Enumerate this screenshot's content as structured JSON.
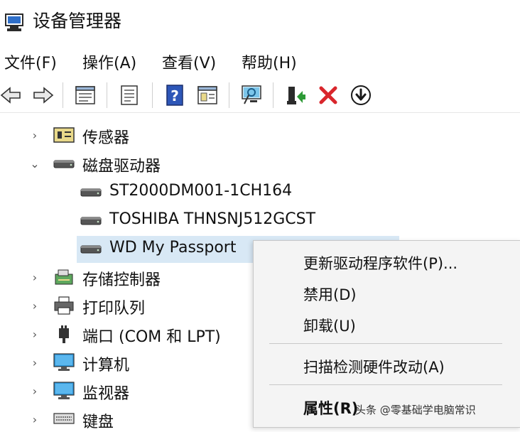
{
  "window": {
    "title": "设备管理器",
    "icon": "device-manager-icon"
  },
  "menu": [
    "文件(F)",
    "操作(A)",
    "查看(V)",
    "帮助(H)"
  ],
  "toolbar": {
    "buttons": [
      "back-arrow-icon",
      "forward-arrow-icon",
      "properties-icon",
      "driver-details-icon",
      "help-icon",
      "action-icon",
      "scan-monitor-icon",
      "update-driver-icon",
      "uninstall-x-icon",
      "download-icon"
    ],
    "uninstall_color": "#d9262c",
    "update_color": "#2d9a36"
  },
  "tree": {
    "items": [
      {
        "label": "传感器",
        "expanded": false
      },
      {
        "label": "磁盘驱动器",
        "expanded": true,
        "children": [
          "ST2000DM001-1CH164",
          "TOSHIBA THNSNJ512GCST",
          "WD My Passport"
        ]
      },
      {
        "label": "存储控制器",
        "expanded": false
      },
      {
        "label": "打印队列",
        "expanded": false
      },
      {
        "label": "端口 (COM 和 LPT)",
        "expanded": false
      },
      {
        "label": "计算机",
        "expanded": false
      },
      {
        "label": "监视器",
        "expanded": false
      },
      {
        "label": "键盘",
        "expanded": false
      }
    ],
    "selected": "WD My Passport",
    "selection_color": "#d8e8f5"
  },
  "context_menu": {
    "items": [
      "更新驱动程序软件(P)...",
      "禁用(D)",
      "卸载(U)",
      "扫描检测硬件改动(A)",
      "属性(R)"
    ]
  },
  "watermark": {
    "prefix": "头条 @",
    "text": "零基础学电脑常识"
  }
}
